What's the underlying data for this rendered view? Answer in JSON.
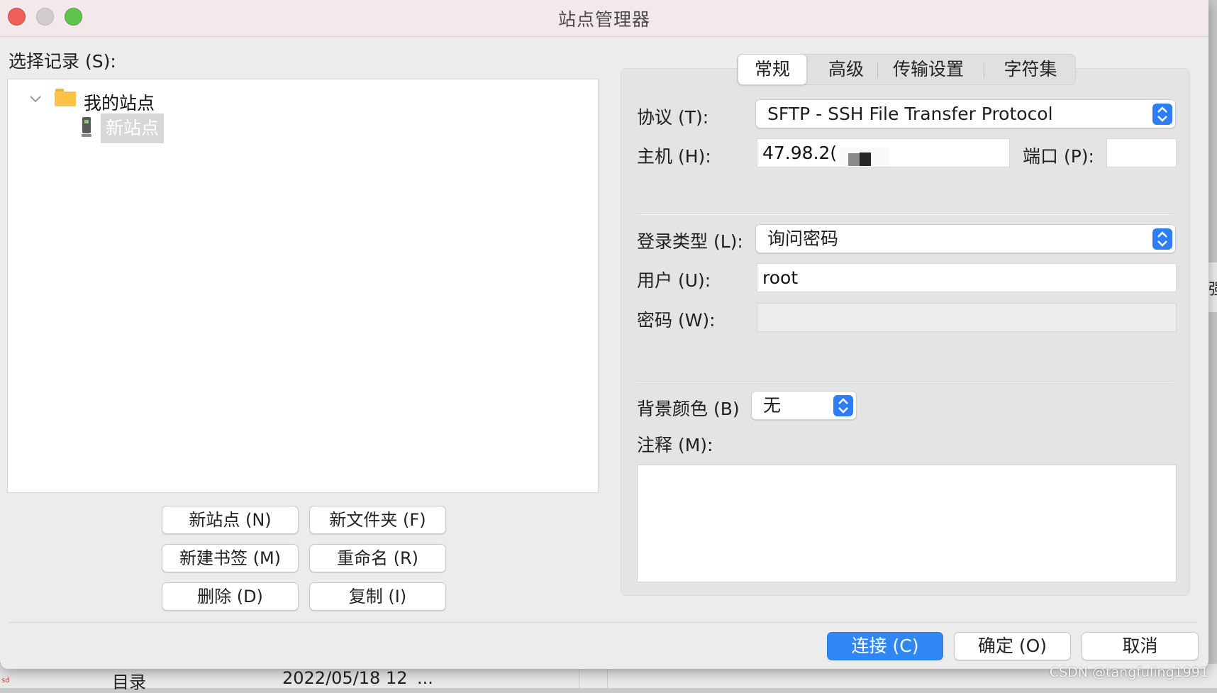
{
  "window": {
    "title": "站点管理器"
  },
  "left": {
    "select_label": "选择记录 (S):",
    "tree": {
      "root_label": "我的站点",
      "child_label": "新站点"
    },
    "buttons": {
      "new_site": "新站点 (N)",
      "new_folder": "新文件夹 (F)",
      "new_bookmark": "新建书签 (M)",
      "rename": "重命名 (R)",
      "delete": "删除 (D)",
      "copy": "复制 (I)"
    }
  },
  "tabs": [
    "常规",
    "高级",
    "传输设置",
    "字符集"
  ],
  "general": {
    "protocol_label": "协议 (T):",
    "protocol_value": "SFTP - SSH File Transfer Protocol",
    "host_label": "主机 (H):",
    "host_value": "47.98.2(",
    "port_label": "端口 (P):",
    "port_value": "",
    "logon_type_label": "登录类型 (L):",
    "logon_type_value": "询问密码",
    "user_label": "用户 (U):",
    "user_value": "root",
    "password_label": "密码 (W):",
    "password_value": "",
    "bg_color_label": "背景颜色 (B)",
    "bg_color_value": "无",
    "comments_label": "注释 (M):",
    "comments_value": ""
  },
  "actions": {
    "connect": "连接 (C)",
    "ok": "确定 (O)",
    "cancel": "取消"
  },
  "background": {
    "col_a": "目录",
    "col_b": "2022/05/18 12",
    "col_b_more": "...",
    "side_glyph": "强",
    "tiny_mark": "sd"
  },
  "watermark": "CSDN @tangfuling1991",
  "colors": {
    "accent": "#2f87f3",
    "stepper": "#2f7df6",
    "folder": "#fbc448"
  }
}
